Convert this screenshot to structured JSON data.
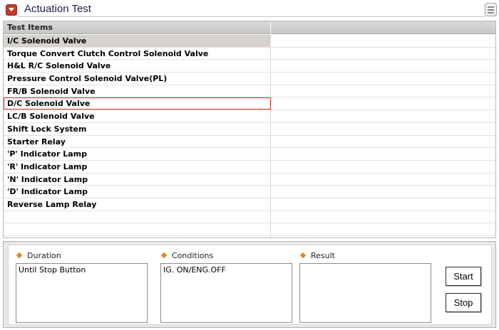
{
  "header": {
    "title": "Actuation Test"
  },
  "table": {
    "columns": [
      "Test Items",
      ""
    ],
    "rows": [
      "I/C Solenoid Valve",
      "Torque Convert Clutch Control Solenoid Valve",
      "H&L R/C Solenoid Valve",
      "Pressure Control Solenoid Valve(PL)",
      "FR/B Solenoid Valve",
      "D/C Solenoid Valve",
      "LC/B Solenoid Valve",
      "Shift Lock System",
      "Starter Relay",
      "'P' Indicator Lamp",
      "'R' Indicator Lamp",
      "'N' Indicator Lamp",
      "'D' Indicator Lamp",
      "Reverse Lamp Relay",
      "",
      "",
      ""
    ]
  },
  "panel": {
    "duration_label": "Duration",
    "duration_value": "Until Stop Button",
    "conditions_label": "Conditions",
    "conditions_value": "IG. ON/ENG.OFF",
    "result_label": "Result",
    "result_value": "",
    "start_label": "Start",
    "stop_label": "Stop"
  },
  "colors": {
    "accent": "#c0392b",
    "title": "#1a1f4d",
    "bullet": "#e08a1e",
    "focus_border": "#d9342b",
    "selected_row": "#d6d2ce"
  }
}
